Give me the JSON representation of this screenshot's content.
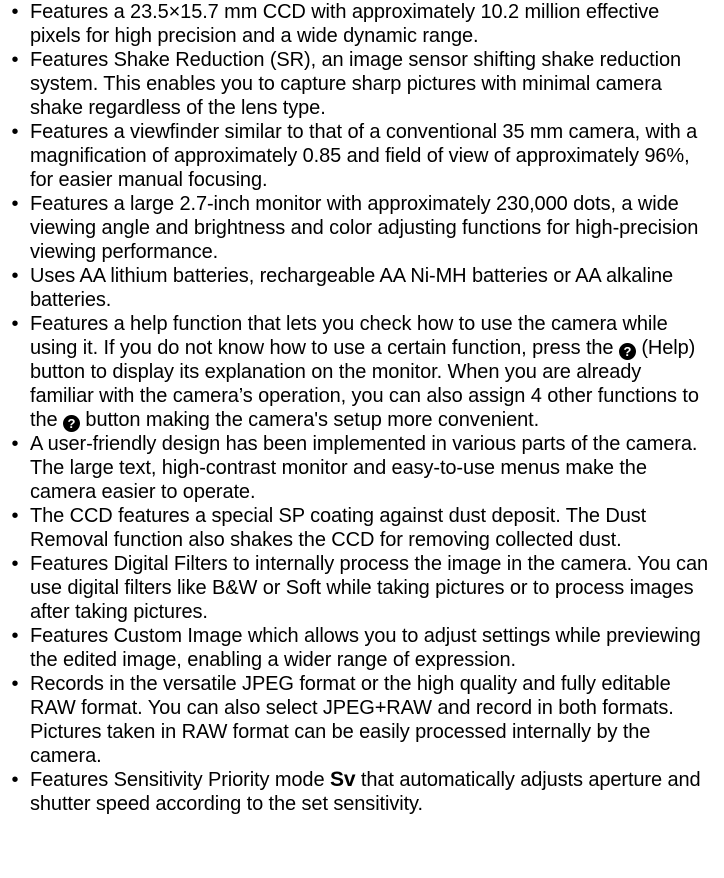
{
  "bullet": "•",
  "help_icon_glyph": "?",
  "items": [
    {
      "text": "Features a 23.5×15.7 mm CCD with approximately 10.2 million effective pixels for high precision and a wide dynamic range."
    },
    {
      "text": "Features Shake Reduction (SR), an image sensor shifting shake reduction system. This enables you to capture sharp pictures with minimal camera shake regardless of the lens type."
    },
    {
      "text": "Features a viewfinder similar to that of a conventional 35 mm camera, with a magnification of approximately 0.85 and field of view of approximately 96%, for easier manual focusing."
    },
    {
      "text": "Features a large 2.7-inch monitor with approximately 230,000 dots, a wide viewing angle and brightness and color adjusting functions for high-precision viewing performance."
    },
    {
      "text": "Uses AA lithium batteries, rechargeable AA Ni-MH batteries or AA alkaline batteries."
    },
    {
      "text_a": "Features a help function that lets you check how to use the camera while using it. If you do not know how to use a certain function, press the ",
      "text_b": " (Help) button to display its explanation on the monitor. When you are already familiar with the camera’s operation, you can also assign 4 other functions to the ",
      "text_c": " button making the camera's setup more convenient."
    },
    {
      "text": "A user-friendly design has been implemented in various parts of the camera. The large text, high-contrast monitor and easy-to-use menus make the camera easier to operate."
    },
    {
      "text": "The CCD features a special SP coating against dust deposit. The Dust Removal function also shakes the CCD for removing collected dust."
    },
    {
      "text": "Features Digital Filters to internally process the image in the camera. You can use digital filters like B&W or Soft while taking pictures or to process images after taking pictures."
    },
    {
      "text": "Features Custom Image which allows you to adjust settings while previewing the edited image, enabling a wider range of expression."
    },
    {
      "text": "Records in the versatile JPEG format or the high quality and fully editable RAW format. You can also select JPEG+RAW and record in both formats. Pictures taken in RAW format can be easily processed internally by the camera."
    },
    {
      "text_a": "Features Sensitivity Priority mode ",
      "mode": "Sv",
      "text_b": " that automatically adjusts aperture and shutter speed according to the set sensitivity."
    }
  ]
}
